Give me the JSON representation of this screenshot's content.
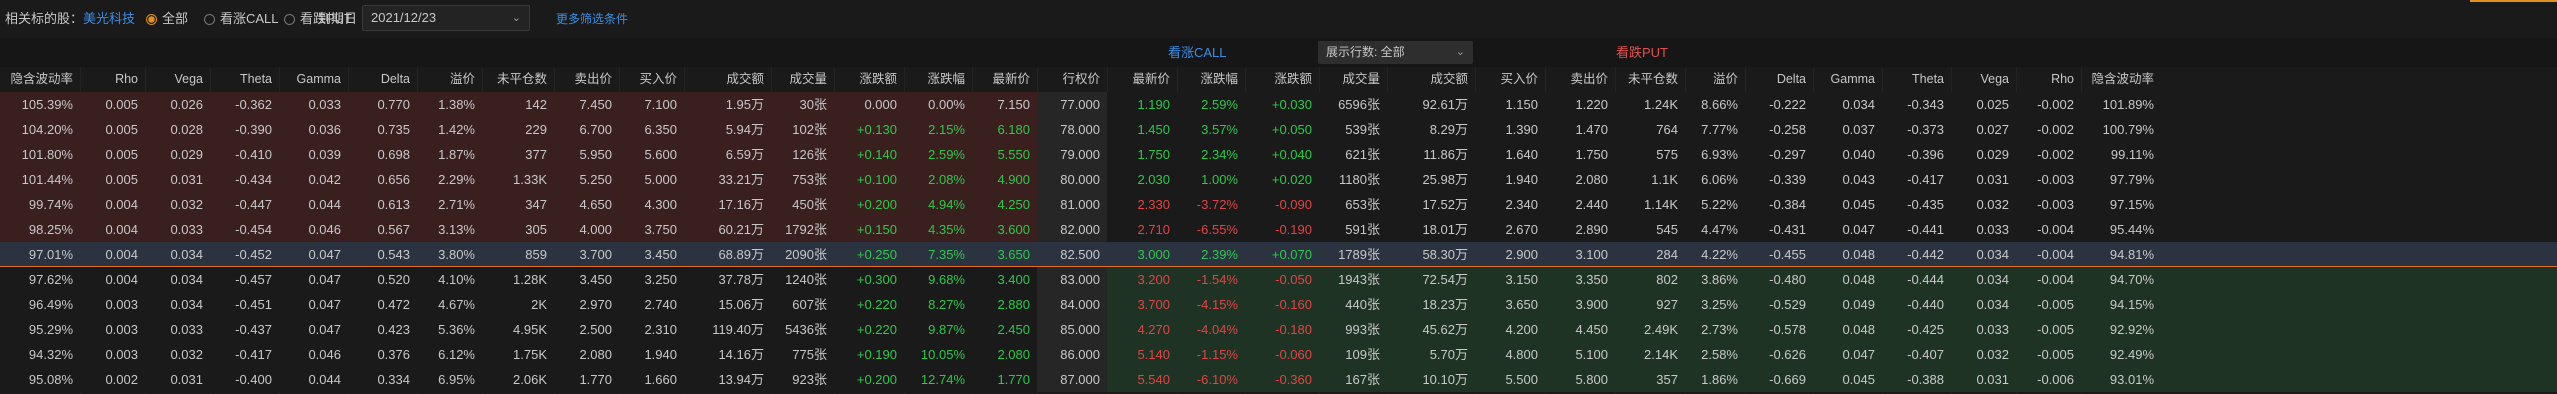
{
  "toolbar": {
    "related_label": "相关标的股：",
    "related_stock": "美光科技",
    "filters": [
      {
        "label": "全部",
        "selected": true
      },
      {
        "label": "看涨CALL",
        "selected": false
      },
      {
        "label": "看跌PUT",
        "selected": false
      }
    ],
    "expiry_label": "到期日",
    "expiry_value": "2021/12/23",
    "more_filters": "更多筛选条件"
  },
  "section": {
    "call_title": "看涨CALL",
    "put_title": "看跌PUT",
    "rows_label": "展示行数: 全部"
  },
  "colors": {
    "up": "#2ec84a",
    "down": "#e04545",
    "call_title": "#3a8ee6",
    "put_title": "#e05050",
    "accent": "#e09020"
  },
  "headers": [
    "隐含波动率",
    "Rho",
    "Vega",
    "Theta",
    "Gamma",
    "Delta",
    "溢价",
    "未平仓数",
    "卖出价",
    "买入价",
    "成交额",
    "成交量",
    "涨跌额",
    "涨跌幅",
    "最新价",
    "行权价",
    "最新价",
    "涨跌幅",
    "涨跌额",
    "成交量",
    "成交额",
    "买入价",
    "卖出价",
    "未平仓数",
    "溢价",
    "Delta",
    "Gamma",
    "Theta",
    "Vega",
    "Rho",
    "隐含波动率"
  ],
  "rows": [
    [
      "105.39%",
      "0.005",
      "0.026",
      "-0.362",
      "0.033",
      "0.770",
      "1.38%",
      "142",
      "7.450",
      "7.100",
      "1.95万",
      "30张",
      "0.000",
      "0.00%",
      "7.150",
      "77.000",
      "1.190",
      "2.59%",
      "+0.030",
      "6596张",
      "92.61万",
      "1.150",
      "1.220",
      "1.24K",
      "8.66%",
      "-0.222",
      "0.034",
      "-0.343",
      "0.025",
      "-0.002",
      "101.89%"
    ],
    [
      "104.20%",
      "0.005",
      "0.028",
      "-0.390",
      "0.036",
      "0.735",
      "1.42%",
      "229",
      "6.700",
      "6.350",
      "5.94万",
      "102张",
      "+0.130",
      "2.15%",
      "6.180",
      "78.000",
      "1.450",
      "3.57%",
      "+0.050",
      "539张",
      "8.29万",
      "1.390",
      "1.470",
      "764",
      "7.77%",
      "-0.258",
      "0.037",
      "-0.373",
      "0.027",
      "-0.002",
      "100.79%"
    ],
    [
      "101.80%",
      "0.005",
      "0.029",
      "-0.410",
      "0.039",
      "0.698",
      "1.87%",
      "377",
      "5.950",
      "5.600",
      "6.59万",
      "126张",
      "+0.140",
      "2.59%",
      "5.550",
      "79.000",
      "1.750",
      "2.34%",
      "+0.040",
      "621张",
      "11.86万",
      "1.640",
      "1.750",
      "575",
      "6.93%",
      "-0.297",
      "0.040",
      "-0.396",
      "0.029",
      "-0.002",
      "99.11%"
    ],
    [
      "101.44%",
      "0.005",
      "0.031",
      "-0.434",
      "0.042",
      "0.656",
      "2.29%",
      "1.33K",
      "5.250",
      "5.000",
      "33.21万",
      "753张",
      "+0.100",
      "2.08%",
      "4.900",
      "80.000",
      "2.030",
      "1.00%",
      "+0.020",
      "1180张",
      "25.98万",
      "1.940",
      "2.080",
      "1.1K",
      "6.06%",
      "-0.339",
      "0.043",
      "-0.417",
      "0.031",
      "-0.003",
      "97.79%"
    ],
    [
      "99.74%",
      "0.004",
      "0.032",
      "-0.447",
      "0.044",
      "0.613",
      "2.71%",
      "347",
      "4.650",
      "4.300",
      "17.16万",
      "450张",
      "+0.200",
      "4.94%",
      "4.250",
      "81.000",
      "2.330",
      "-3.72%",
      "-0.090",
      "653张",
      "17.52万",
      "2.340",
      "2.440",
      "1.14K",
      "5.22%",
      "-0.384",
      "0.045",
      "-0.435",
      "0.032",
      "-0.003",
      "97.15%"
    ],
    [
      "98.25%",
      "0.004",
      "0.033",
      "-0.454",
      "0.046",
      "0.567",
      "3.13%",
      "305",
      "4.000",
      "3.750",
      "60.21万",
      "1792张",
      "+0.150",
      "4.35%",
      "3.600",
      "82.000",
      "2.710",
      "-6.55%",
      "-0.190",
      "591张",
      "18.01万",
      "2.670",
      "2.890",
      "545",
      "4.47%",
      "-0.431",
      "0.047",
      "-0.441",
      "0.033",
      "-0.004",
      "95.44%"
    ],
    [
      "97.01%",
      "0.004",
      "0.034",
      "-0.452",
      "0.047",
      "0.543",
      "3.80%",
      "859",
      "3.700",
      "3.450",
      "68.89万",
      "2090张",
      "+0.250",
      "7.35%",
      "3.650",
      "82.500",
      "3.000",
      "2.39%",
      "+0.070",
      "1789张",
      "58.30万",
      "2.900",
      "3.100",
      "284",
      "4.22%",
      "-0.455",
      "0.048",
      "-0.442",
      "0.034",
      "-0.004",
      "94.81%"
    ],
    [
      "97.62%",
      "0.004",
      "0.034",
      "-0.457",
      "0.047",
      "0.520",
      "4.10%",
      "1.28K",
      "3.450",
      "3.250",
      "37.78万",
      "1240张",
      "+0.300",
      "9.68%",
      "3.400",
      "83.000",
      "3.200",
      "-1.54%",
      "-0.050",
      "1943张",
      "72.54万",
      "3.150",
      "3.350",
      "802",
      "3.86%",
      "-0.480",
      "0.048",
      "-0.444",
      "0.034",
      "-0.004",
      "94.70%"
    ],
    [
      "96.49%",
      "0.003",
      "0.034",
      "-0.451",
      "0.047",
      "0.472",
      "4.67%",
      "2K",
      "2.970",
      "2.740",
      "15.06万",
      "607张",
      "+0.220",
      "8.27%",
      "2.880",
      "84.000",
      "3.700",
      "-4.15%",
      "-0.160",
      "440张",
      "18.23万",
      "3.650",
      "3.900",
      "927",
      "3.25%",
      "-0.529",
      "0.049",
      "-0.440",
      "0.034",
      "-0.005",
      "94.15%"
    ],
    [
      "95.29%",
      "0.003",
      "0.033",
      "-0.437",
      "0.047",
      "0.423",
      "5.36%",
      "4.95K",
      "2.500",
      "2.310",
      "119.40万",
      "5436张",
      "+0.220",
      "9.87%",
      "2.450",
      "85.000",
      "4.270",
      "-4.04%",
      "-0.180",
      "993张",
      "45.62万",
      "4.200",
      "4.450",
      "2.49K",
      "2.73%",
      "-0.578",
      "0.048",
      "-0.425",
      "0.033",
      "-0.005",
      "92.92%"
    ],
    [
      "94.32%",
      "0.003",
      "0.032",
      "-0.417",
      "0.046",
      "0.376",
      "6.12%",
      "1.75K",
      "2.080",
      "1.940",
      "14.16万",
      "775张",
      "+0.190",
      "10.05%",
      "2.080",
      "86.000",
      "5.140",
      "-1.15%",
      "-0.060",
      "109张",
      "5.70万",
      "4.800",
      "5.100",
      "2.14K",
      "2.58%",
      "-0.626",
      "0.047",
      "-0.407",
      "0.032",
      "-0.005",
      "92.49%"
    ],
    [
      "95.08%",
      "0.002",
      "0.031",
      "-0.400",
      "0.044",
      "0.334",
      "6.95%",
      "2.06K",
      "1.770",
      "1.660",
      "13.94万",
      "923张",
      "+0.200",
      "12.74%",
      "1.770",
      "87.000",
      "5.540",
      "-6.10%",
      "-0.360",
      "167张",
      "10.10万",
      "5.500",
      "5.800",
      "357",
      "1.86%",
      "-0.669",
      "0.045",
      "-0.388",
      "0.031",
      "-0.006",
      "93.01%"
    ]
  ]
}
